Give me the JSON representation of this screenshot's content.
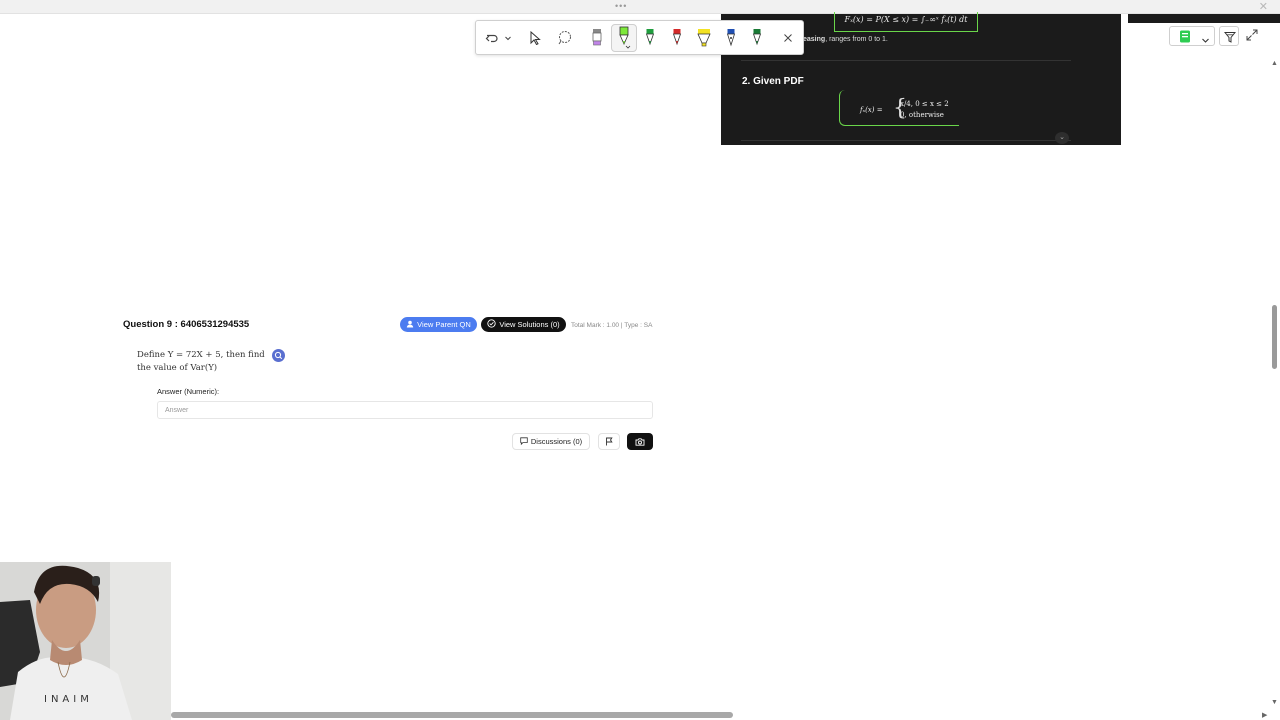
{
  "window": {
    "grabber": "•••",
    "close_icon": "close-icon"
  },
  "toolbar": {
    "icons": [
      "undo-icon",
      "undo-dropdown-icon",
      "pointer-icon",
      "lasso-icon",
      "highlighter-purple-icon",
      "pen-lime-icon",
      "pen-green-icon",
      "pen-red-icon",
      "highlighter-yellow-icon",
      "fountain-pen-blue-icon",
      "pen-darkgreen-icon",
      "close-icon"
    ],
    "pen_colors": {
      "purple": "#c084e8",
      "lime": "#7de83a",
      "green": "#1f9e3e",
      "red": "#d42a2a",
      "yellow": "#f3e224",
      "blue": "#1f4fb3",
      "darkgreen": "#1a7a36"
    }
  },
  "solution_panel": {
    "formula_top": "Fₓ(x) = P(X ≤ x) = ∫₋∞ˣ fₓ(t) dt",
    "line1_bold": "easing",
    "line1_rest": ", ranges from 0 to 1.",
    "given_title": "2. Given PDF",
    "pdf_lhs": "fₓ(x) =",
    "pdf_row1": "x/4,   0 ≤ x ≤ 2",
    "pdf_row2": "0,   otherwise",
    "collapse_icon": "chevron-down-icon",
    "accent": "#6ad64a"
  },
  "corner_controls": {
    "icons": [
      "notebook-icon",
      "chevron-down-icon",
      "filter-icon",
      "expand-icon"
    ],
    "notebook_color": "#2ecc52"
  },
  "question": {
    "title": "Question 9 : 6406531294535",
    "view_parent_label": "View Parent QN",
    "view_solutions_label": "View Solutions (0)",
    "meta": "Total Mark : 1.00 | Type : SA",
    "body_line1": "Define Y = 72X + 5, then find",
    "body_line2": "the value of Var(Y)",
    "answer_label": "Answer (Numeric):",
    "answer_placeholder": "Answer",
    "answer_value": "",
    "discussions_label": "Discussions (0)",
    "icons": [
      "user-icon",
      "check-circle-icon",
      "zoom-icon",
      "chat-icon",
      "flag-icon",
      "camera-icon"
    ],
    "accent": "#4c7cf0"
  },
  "webcam": {
    "shirt_text": "INAIM"
  }
}
